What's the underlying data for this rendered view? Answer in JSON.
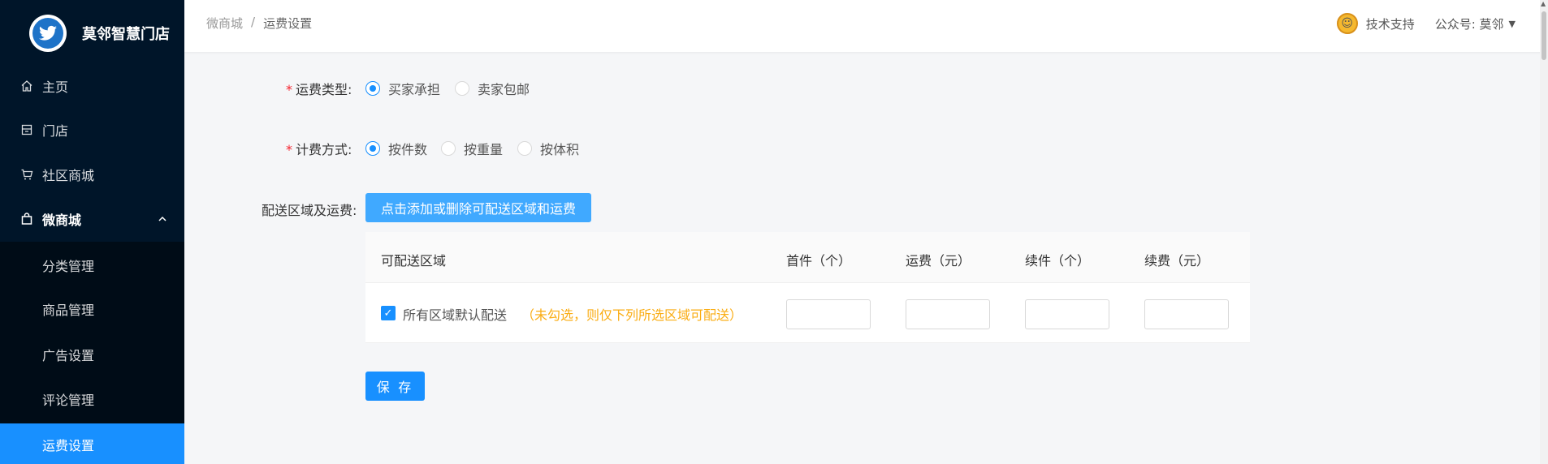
{
  "brand": {
    "name": "莫邻智慧门店",
    "logo_icon": "bird-logo-icon"
  },
  "sidebar": {
    "items": [
      {
        "label": "主页",
        "icon": "home-icon"
      },
      {
        "label": "门店",
        "icon": "store-icon"
      },
      {
        "label": "社区商城",
        "icon": "cart-icon"
      },
      {
        "label": "微商城",
        "icon": "shopping-bag-icon",
        "expanded": true
      }
    ],
    "submenu": [
      {
        "label": "分类管理"
      },
      {
        "label": "商品管理"
      },
      {
        "label": "广告设置"
      },
      {
        "label": "评论管理"
      },
      {
        "label": "运费设置",
        "active": true
      }
    ]
  },
  "header": {
    "breadcrumb": [
      "微商城",
      "运费设置"
    ],
    "separator": "/",
    "support_label": "技术支持",
    "account_label": "公众号: 莫邻"
  },
  "form": {
    "shipping_type": {
      "label": "运费类型:",
      "options": [
        {
          "label": "买家承担",
          "checked": true
        },
        {
          "label": "卖家包邮",
          "checked": false
        }
      ]
    },
    "billing_method": {
      "label": "计费方式:",
      "options": [
        {
          "label": "按件数",
          "checked": true
        },
        {
          "label": "按重量",
          "checked": false
        },
        {
          "label": "按体积",
          "checked": false
        }
      ]
    },
    "delivery": {
      "label": "配送区域及运费:",
      "add_button": "点击添加或删除可配送区域和运费"
    },
    "table": {
      "headers": [
        "可配送区域",
        "首件（个）",
        "运费（元）",
        "续件（个）",
        "续费（元）"
      ],
      "row": {
        "checked": true,
        "label": "所有区域默认配送",
        "hint": "（未勾选，则仅下列所选区域可配送）",
        "inputs": [
          "",
          "",
          "",
          ""
        ]
      }
    },
    "save_button": "保 存"
  },
  "colors": {
    "sidebar_bg": "#001529",
    "accent": "#1890ff",
    "hint": "#faad14",
    "required": "#f5222d"
  }
}
